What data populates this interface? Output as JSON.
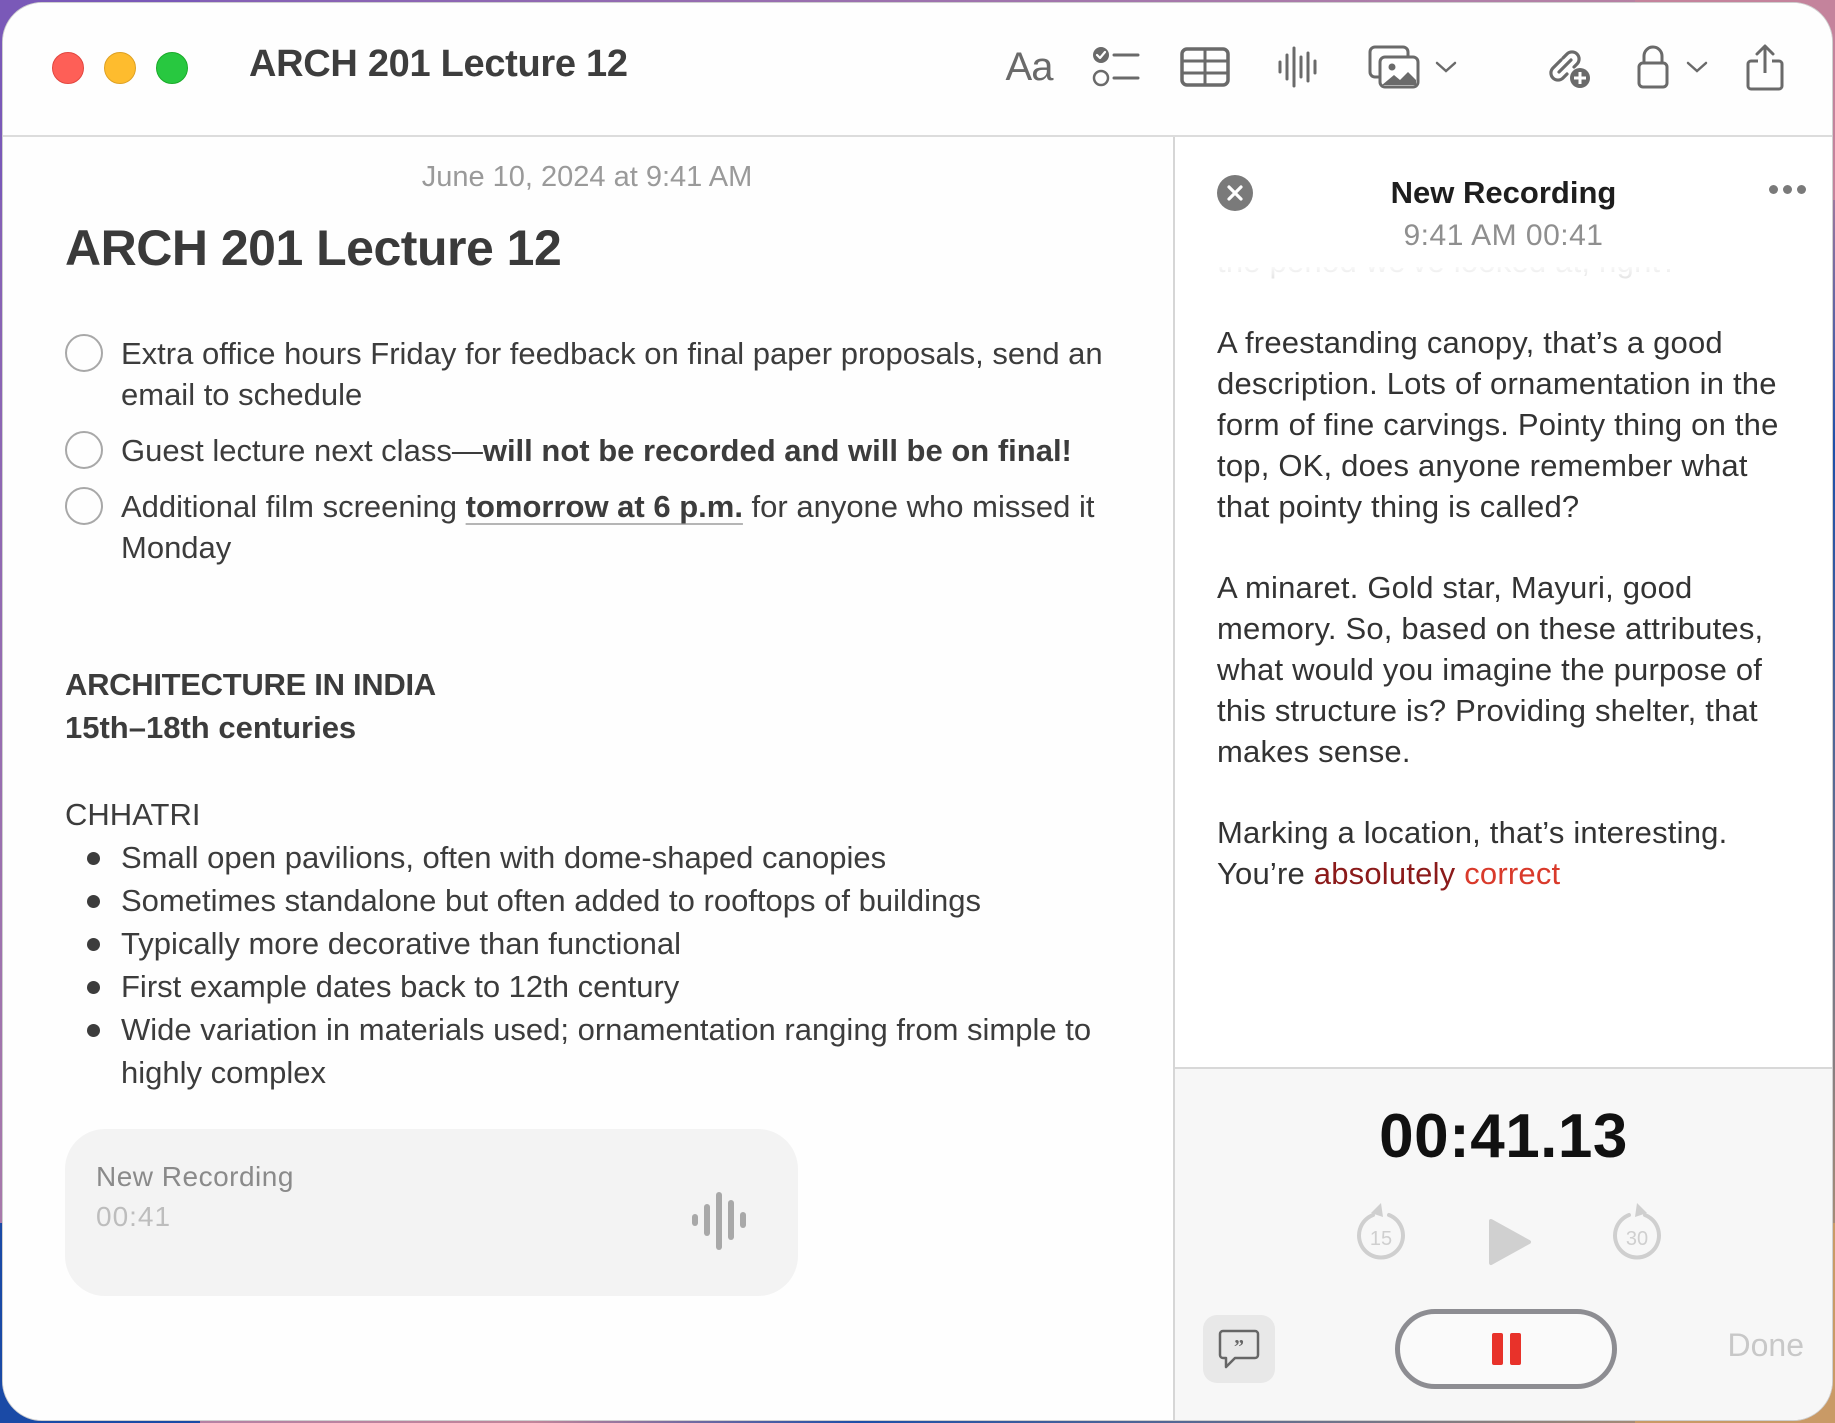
{
  "window": {
    "title": "ARCH 201 Lecture 12",
    "traffic_lights": [
      "close",
      "minimize",
      "zoom"
    ]
  },
  "toolbar": {
    "format_label": "Aa",
    "icons": [
      "format-text-icon",
      "checklist-icon",
      "table-icon",
      "audio-waveform-icon",
      "media-icon",
      "chevron-down-icon",
      "collaborate-link-icon",
      "lock-icon",
      "chevron-down-icon",
      "share-icon"
    ]
  },
  "note": {
    "date": "June 10, 2024 at 9:41 AM",
    "title": "ARCH 201 Lecture 12",
    "checklist": [
      {
        "text": "Extra office hours Friday for feedback on final paper proposals, send an email to schedule",
        "checked": false
      },
      {
        "text_plain": "Guest lecture next class—",
        "text_bold": "will not be recorded and will be on final!",
        "checked": false
      },
      {
        "text_before": "Additional film screening ",
        "text_link": "tomorrow at 6 p.m.",
        "text_after": " for anyone who missed it Monday",
        "checked": false
      }
    ],
    "heading": "ARCHITECTURE IN INDIA",
    "subheading": "15th–18th centuries",
    "section_label": "CHHATRI",
    "bullets": [
      "Small open pavilions, often with dome-shaped canopies",
      "Sometimes standalone but often added to rooftops of buildings",
      "Typically more decorative than functional",
      "First example dates back to 12th century",
      "Wide variation in materials used; ornamentation ranging from simple to highly complex"
    ],
    "recording_card": {
      "title": "New Recording",
      "duration": "00:41"
    }
  },
  "recording": {
    "title": "New Recording",
    "subtitle": "9:41 AM 00:41",
    "transcript": {
      "faded_line": "the period we've looked at, right?",
      "paragraph1": "A freestanding canopy, that’s a good description. Lots of ornamentation in the form of fine carvings. Pointy thing on the top, OK, does anyone remember what that pointy thing is called?",
      "paragraph2": "A minaret. Gold star, Mayuri, good memory. So, based on these attributes, what would you imagine the purpose of this structure is? Providing shelter, that makes sense.",
      "paragraph3_plain": "Marking a location, that’s interesting. You’re ",
      "paragraph3_highlight1": "absolutely",
      "paragraph3_space": " ",
      "paragraph3_highlight2": "correct"
    },
    "timer": "00:41.13",
    "skip_back_seconds": "15",
    "skip_forward_seconds": "30",
    "done_label": "Done",
    "colors": {
      "record_red": "#e8322a",
      "highlight_dark": "#8b1a1a",
      "highlight_red": "#d93a2b"
    }
  }
}
